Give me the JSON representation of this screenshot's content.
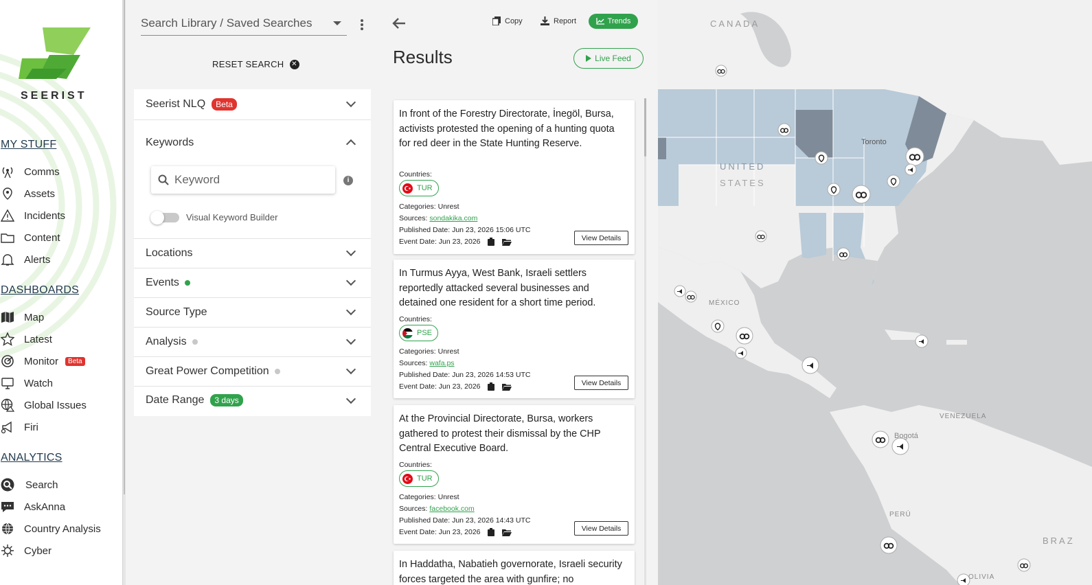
{
  "brand": {
    "name": "SEERIST"
  },
  "sidebar": {
    "my_stuff": {
      "heading": "MY STUFF",
      "items": [
        {
          "label": "Comms",
          "icon": "antenna-icon"
        },
        {
          "label": "Assets",
          "icon": "map-pin-icon"
        },
        {
          "label": "Incidents",
          "icon": "warning-icon"
        },
        {
          "label": "Content",
          "icon": "folder-icon"
        },
        {
          "label": "Alerts",
          "icon": "bell-icon"
        }
      ]
    },
    "dashboards": {
      "heading": "DASHBOARDS",
      "items": [
        {
          "label": "Map",
          "icon": "map-icon"
        },
        {
          "label": "Latest",
          "icon": "star-icon"
        },
        {
          "label": "Monitor",
          "icon": "radar-icon",
          "badge": "Beta"
        },
        {
          "label": "Watch",
          "icon": "monitor-icon"
        },
        {
          "label": "Global Issues",
          "icon": "globe-warning-icon"
        },
        {
          "label": "Firi",
          "icon": "megaphone-icon"
        }
      ]
    },
    "analytics": {
      "heading": "ANALYTICS",
      "items": [
        {
          "label": "Search",
          "icon": "search-icon"
        },
        {
          "label": "AskAnna",
          "icon": "chat-icon"
        },
        {
          "label": "Country Analysis",
          "icon": "globe-icon"
        },
        {
          "label": "Cyber",
          "icon": "virus-icon"
        }
      ]
    }
  },
  "filters": {
    "search_library": "Search Library / Saved Searches",
    "reset_label": "RESET SEARCH",
    "nlq": {
      "label": "Seerist NLQ",
      "badge": "Beta"
    },
    "keywords": {
      "label": "Keywords",
      "placeholder": "Keyword",
      "toggle_label": "Visual Keyword Builder"
    },
    "locations": "Locations",
    "events": "Events",
    "source_type": "Source Type",
    "analysis": "Analysis",
    "gpc": "Great Power Competition",
    "date_range": {
      "label": "Date Range",
      "badge": "3 days"
    },
    "colors": {
      "active_dot": "#31a24c",
      "inactive_dot": "#c8c8c8"
    }
  },
  "results": {
    "toolbar": {
      "copy": "Copy",
      "report": "Report",
      "trends": "Trends"
    },
    "title": "Results",
    "live_feed": "Live Feed",
    "labels": {
      "countries": "Countries:",
      "categories": "Categories:",
      "sources": "Sources:",
      "published": "Published Date:",
      "event_date": "Event Date:",
      "view_details": "View Details"
    },
    "cards": [
      {
        "title": "In front of the Forestry Directorate, İnegöl, Bursa, activists protested the opening of a hunting quota for red deer in the State Hunting Reserve.",
        "country": "TUR",
        "category": "Unrest",
        "source": "sondakika.com",
        "published": "Jun 23, 2026 15:06 UTC",
        "event_date": "Jun 23, 2026"
      },
      {
        "title": "In Turmus Ayya, West Bank, Israeli settlers reportedly attacked several businesses and detained one resident for a short time period.",
        "country": "PSE",
        "category": "Unrest",
        "source": "wafa.ps",
        "published": "Jun 23, 2026 14:53 UTC",
        "event_date": "Jun 23, 2026"
      },
      {
        "title": "At the Provincial Directorate, Bursa, workers gathered to protest their dismissal by the CHP Central Executive Board.",
        "country": "TUR",
        "category": "Unrest",
        "source": "facebook.com",
        "published": "Jun 23, 2026 14:43 UTC",
        "event_date": "Jun 23, 2026"
      },
      {
        "title": "In Haddatha, Nabatieh governorate, Israeli security forces targeted the area with gunfire; no"
      }
    ]
  },
  "map": {
    "labels": [
      "CANADA",
      "UNITED",
      "STATES",
      "MÉXICO",
      "VENEZUELA",
      "PERÚ",
      "BRAZ",
      "Toronto",
      "Bogotá",
      "OLIVIA"
    ]
  }
}
